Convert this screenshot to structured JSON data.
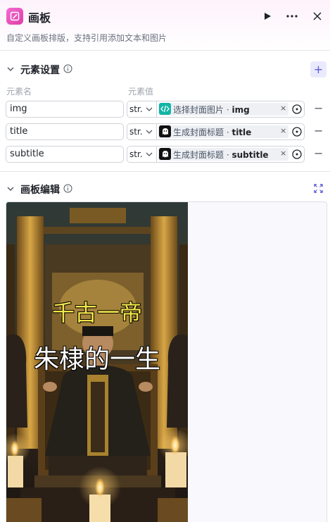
{
  "header": {
    "title": "画板",
    "subtitle": "自定义画板排版，支持引用添加文本和图片",
    "icon": "canvas-edit-icon",
    "accent": "#e03ca6"
  },
  "elements_section": {
    "title": "元素设置",
    "add_label": "+",
    "col_name": "元素名",
    "col_value": "元素值",
    "rows": [
      {
        "name": "img",
        "type": "str.",
        "ref_prefix": "选择封面图片 · ",
        "ref_field": "img",
        "ref_icon": "code-plugin-icon"
      },
      {
        "name": "title",
        "type": "str.",
        "ref_prefix": "生成封面标题 · ",
        "ref_field": "title",
        "ref_icon": "llm-icon"
      },
      {
        "name": "subtitle",
        "type": "str.",
        "ref_prefix": "生成封面标题 · ",
        "ref_field": "subtitle",
        "ref_icon": "llm-icon"
      }
    ]
  },
  "canvas_section": {
    "title": "画板编辑",
    "canvas_title": "千古一帝",
    "canvas_subtitle": "朱棣的一生"
  },
  "colors": {
    "title_text": "#f2e64a",
    "subtitle_text": "#ffffff",
    "canvas_bg": "#f9f9fd",
    "add_button_bg": "#eaeafd"
  }
}
